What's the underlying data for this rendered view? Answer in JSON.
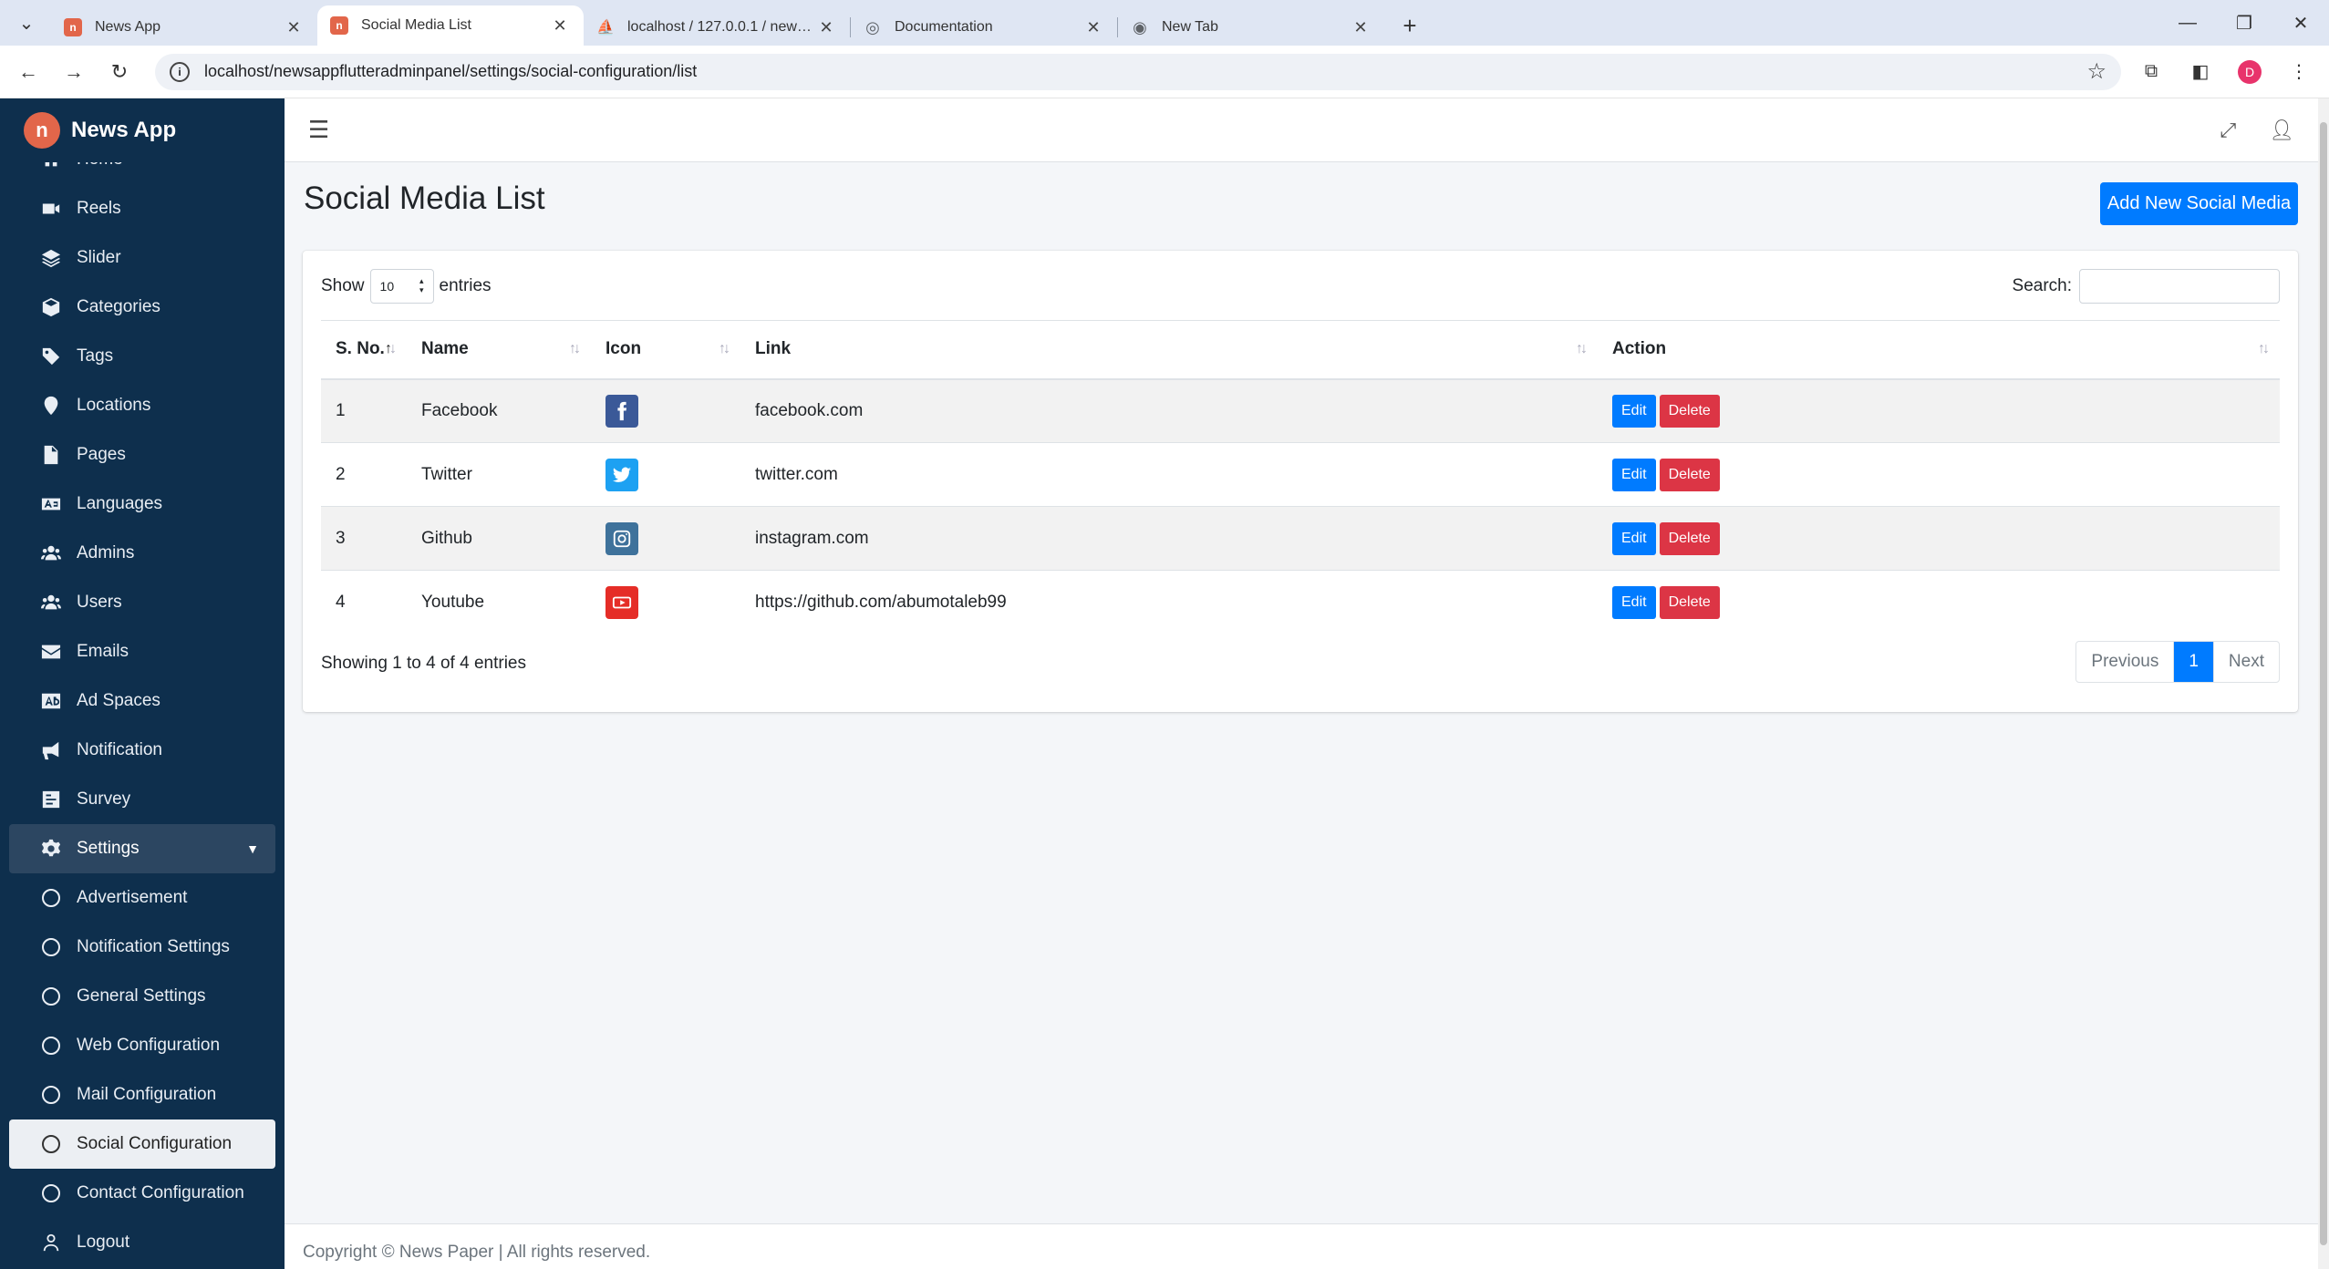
{
  "browser": {
    "tabs": [
      {
        "label": "News App",
        "favicon_color": "#e2664a",
        "active": false
      },
      {
        "label": "Social Media List",
        "favicon_color": "#e2664a",
        "active": true
      },
      {
        "label": "localhost / 127.0.0.1 / news_app",
        "favicon_color": "#f29111",
        "active": false
      },
      {
        "label": "Documentation",
        "favicon_color": "#5f6368",
        "active": false
      },
      {
        "label": "New Tab",
        "favicon_color": "#5f6368",
        "active": false
      }
    ],
    "url": "localhost/newsappflutteradminpanel/settings/social-configuration/list",
    "profile_initial": "D"
  },
  "sidebar": {
    "brand": "News App",
    "items": [
      {
        "label": "Home",
        "icon": "home-icon"
      },
      {
        "label": "Reels",
        "icon": "video-icon"
      },
      {
        "label": "Slider",
        "icon": "layers-icon"
      },
      {
        "label": "Categories",
        "icon": "cube-icon"
      },
      {
        "label": "Tags",
        "icon": "tag-icon"
      },
      {
        "label": "Locations",
        "icon": "map-marker-icon"
      },
      {
        "label": "Pages",
        "icon": "file-icon"
      },
      {
        "label": "Languages",
        "icon": "language-icon"
      },
      {
        "label": "Admins",
        "icon": "users-icon"
      },
      {
        "label": "Users",
        "icon": "users-icon"
      },
      {
        "label": "Emails",
        "icon": "envelope-icon"
      },
      {
        "label": "Ad Spaces",
        "icon": "ad-icon"
      },
      {
        "label": "Notification",
        "icon": "bullhorn-icon"
      },
      {
        "label": "Survey",
        "icon": "poll-icon"
      },
      {
        "label": "Settings",
        "icon": "gear-icon"
      }
    ],
    "settings_sub": [
      "Advertisement",
      "Notification Settings",
      "General Settings",
      "Web Configuration",
      "Mail Configuration",
      "Social Configuration",
      "Contact Configuration"
    ],
    "logout": "Logout"
  },
  "main": {
    "title": "Social Media List",
    "add_button": "Add New Social Media",
    "show_label": "Show",
    "entries_label": "entries",
    "page_length": "10",
    "search_label": "Search:",
    "columns": [
      "S. No.",
      "Name",
      "Icon",
      "Link",
      "Action"
    ],
    "rows": [
      {
        "sno": "1",
        "name": "Facebook",
        "icon": "facebook-icon",
        "icon_color": "#3b5998",
        "link": "facebook.com"
      },
      {
        "sno": "2",
        "name": "Twitter",
        "icon": "twitter-icon",
        "icon_color": "#1da1f2",
        "link": "twitter.com"
      },
      {
        "sno": "3",
        "name": "Github",
        "icon": "instagram-icon",
        "icon_color": "#3f729b",
        "link": "instagram.com"
      },
      {
        "sno": "4",
        "name": "Youtube",
        "icon": "youtube-icon",
        "icon_color": "#e52d27",
        "link": "https://github.com/abumotaleb99"
      }
    ],
    "edit_label": "Edit",
    "delete_label": "Delete",
    "info": "Showing 1 to 4 of 4 entries",
    "pager": {
      "prev": "Previous",
      "current": "1",
      "next": "Next"
    }
  },
  "footer": "Copyright © News Paper | All rights reserved."
}
